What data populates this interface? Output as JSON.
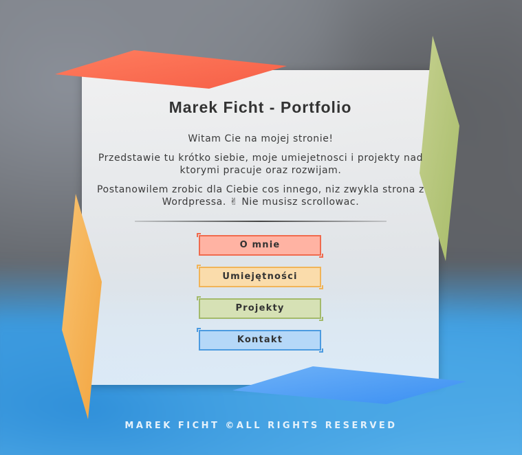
{
  "header": {
    "title": "Marek Ficht - Portfolio"
  },
  "intro": {
    "greeting": "Witam Cie na mojej stronie!",
    "about": "Przedstawie tu krótko siebie, moje umiejetnosci i projekty nad ktorymi pracuje oraz rozwijam.",
    "note": "Postanowilem zrobic dla Ciebie cos innego, niz zwykla strona z Wordpressa. ✌ Nie musisz scrollowac."
  },
  "nav": {
    "items": [
      {
        "label": "O mnie",
        "accent": "#f06a4d"
      },
      {
        "label": "Umiejętności",
        "accent": "#f1b457"
      },
      {
        "label": "Projekty",
        "accent": "#a3ba6b"
      },
      {
        "label": "Kontakt",
        "accent": "#4c9be0"
      }
    ]
  },
  "footer": {
    "text": "MAREK FICHT ©ALL RIGHTS RESERVED"
  },
  "decor": {
    "colors": {
      "red": "#ff6f55",
      "green": "#b9c97b",
      "orange": "#f5b04f",
      "blue": "#4f9ff5"
    }
  }
}
